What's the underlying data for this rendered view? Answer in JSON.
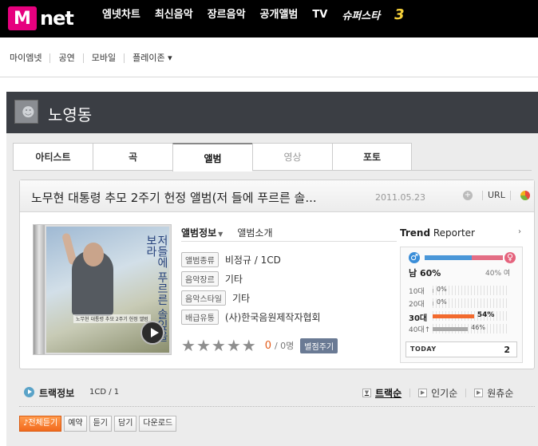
{
  "header": {
    "logo_m": "M",
    "logo_net": "net",
    "nav": [
      "엠넷차트",
      "최신음악",
      "장르음악",
      "공개앨범",
      "TV"
    ],
    "promo": "슈퍼스타",
    "promo_num": "3"
  },
  "subnav": {
    "items": [
      "마이엠넷",
      "공연",
      "모바일",
      "플레이존 ▾"
    ]
  },
  "artist": {
    "name": "노영동"
  },
  "tabs": [
    {
      "label": "아티스트",
      "state": "normal"
    },
    {
      "label": "곡",
      "state": "normal"
    },
    {
      "label": "앨범",
      "state": "active"
    },
    {
      "label": "영상",
      "state": "disabled"
    },
    {
      "label": "포토",
      "state": "normal"
    }
  ],
  "album": {
    "title": "노무현 대통령 추모 2주기 헌정 앨범(저 들에 푸르른 솔...",
    "date": "2011.05.23",
    "url_label": "URL",
    "cover_vtext": "저들에 푸르른 솔잎을 보라",
    "cover_small": "노무현 대통령 추모 2주기 헌정 앨범",
    "subtabs": {
      "info": "앨범정보",
      "intro": "앨범소개"
    },
    "info": [
      {
        "label": "앨범종류",
        "value": "비정규 / 1CD"
      },
      {
        "label": "음악장르",
        "value": "기타"
      },
      {
        "label": "음악스타일",
        "value": "기타"
      },
      {
        "label": "배급유통",
        "value": "(사)한국음원제작자협회"
      }
    ],
    "rating": {
      "score": "0",
      "count": "/ 0명",
      "button": "별점주기",
      "stars": 5
    }
  },
  "trend": {
    "title_bold": "Trend",
    "title_rest": " Reporter",
    "more": "›",
    "male_label": "남",
    "male_pct": 60,
    "female_label": "여",
    "female_pct": 40,
    "male_text": "60%",
    "female_text": "40%",
    "ages": [
      {
        "label": "10대",
        "pct": 0,
        "text": "0%",
        "highlight": false
      },
      {
        "label": "20대",
        "pct": 0,
        "text": "0%",
        "highlight": false
      },
      {
        "label": "30대",
        "pct": 54,
        "text": "54%",
        "highlight": true
      },
      {
        "label": "40대↑",
        "pct": 46,
        "text": "46%",
        "highlight": false
      }
    ],
    "today_label": "TODAY",
    "today_value": "2"
  },
  "tracks": {
    "title": "트랙정보",
    "cd": "1CD / 1",
    "sorts": [
      {
        "label": "트랙순",
        "on": true
      },
      {
        "label": "인기순",
        "on": false
      },
      {
        "label": "원츄순",
        "on": false
      }
    ],
    "actions": [
      "전체듣기",
      "예약",
      "듣기",
      "담기",
      "다운로드"
    ]
  }
}
